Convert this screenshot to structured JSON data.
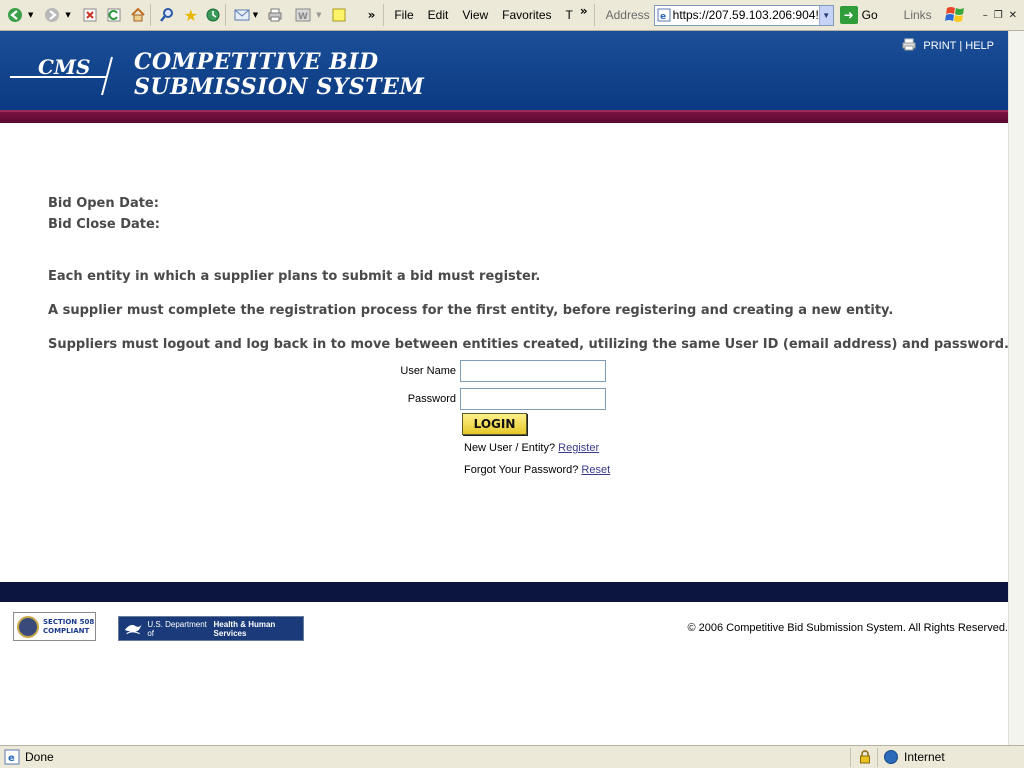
{
  "browser": {
    "menu": [
      "File",
      "Edit",
      "View",
      "Favorites",
      "T"
    ],
    "overflow": "»",
    "address_label": "Address",
    "address_url": "https://207.59.103.206:904!",
    "go_label": "Go",
    "links_label": "Links",
    "status_text": "Done",
    "zone_text": "Internet"
  },
  "header": {
    "logo_text": "CMS",
    "title_line1": "COMPETITIVE BID",
    "title_line2": "SUBMISSION SYSTEM",
    "print_label": "PRINT",
    "separator": "|",
    "help_label": "HELP"
  },
  "content": {
    "bid_open_label": "Bid Open Date:",
    "bid_close_label": "Bid Close Date:",
    "notice1": "Each entity in which a supplier plans to submit a bid must register.",
    "notice2": "A supplier must complete the registration process for the first entity, before registering and creating a new entity.",
    "notice3": "Suppliers must logout and log back in to move between entities created, utilizing the same User ID (email address) and password."
  },
  "login": {
    "username_label": "User Name",
    "username_value": "",
    "password_label": "Password",
    "password_value": "",
    "login_button": "LOGIN",
    "new_user_text": "New User / Entity?",
    "register_link": "Register",
    "forgot_text": "Forgot Your Password?",
    "reset_link": "Reset"
  },
  "footer": {
    "badge_508_line1": "SECTION 508",
    "badge_508_line2": "COMPLIANT",
    "hhs_text_prefix": "U.S. Department of",
    "hhs_text_bold": "Health & Human Services",
    "copyright": "© 2006 Competitive Bid Submission System. All Rights Reserved."
  },
  "colors": {
    "header_blue": "#0a3a82",
    "accent_maroon": "#6a0c38",
    "footer_navy": "#0c1440",
    "login_yellow": "#f2dc55"
  }
}
